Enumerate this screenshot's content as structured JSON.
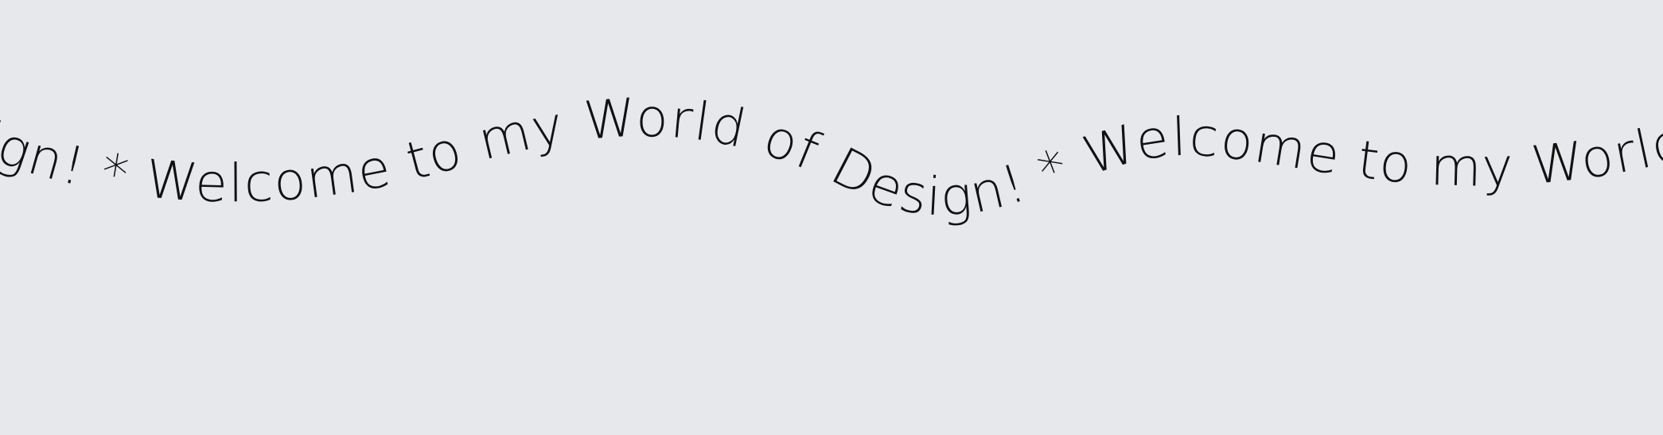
{
  "banner": {
    "text": "sign! * Welcome to my World of Design! * Welcome to my World of Design! * Welcome to my World of",
    "text_color": "#111111",
    "background_color": "#e7e8eb"
  }
}
